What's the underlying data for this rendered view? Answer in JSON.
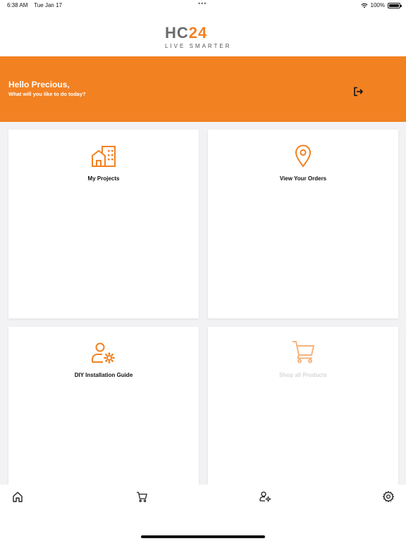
{
  "status": {
    "time": "6:38 AM",
    "date": "Tue Jan 17",
    "battery": "100%"
  },
  "brand": {
    "logo_left": "HC",
    "logo_right": "24",
    "tagline": "LIVE SMARTER",
    "accent": "#f28122"
  },
  "banner": {
    "greeting": "Hello Precious,",
    "subtitle": "What will you like to do today?",
    "logout_icon": "logout-icon"
  },
  "cards": [
    {
      "label": "My Projects",
      "icon": "building-icon",
      "enabled": true
    },
    {
      "label": "View Your Orders",
      "icon": "location-pin-icon",
      "enabled": true
    },
    {
      "label": "DIY Installation Guide",
      "icon": "user-gear-icon",
      "enabled": true
    },
    {
      "label": "Shop all Products",
      "icon": "cart-icon",
      "enabled": false
    }
  ],
  "tabbar": [
    {
      "icon": "home-icon"
    },
    {
      "icon": "cart-icon"
    },
    {
      "icon": "user-gear-icon"
    },
    {
      "icon": "gear-icon"
    }
  ]
}
